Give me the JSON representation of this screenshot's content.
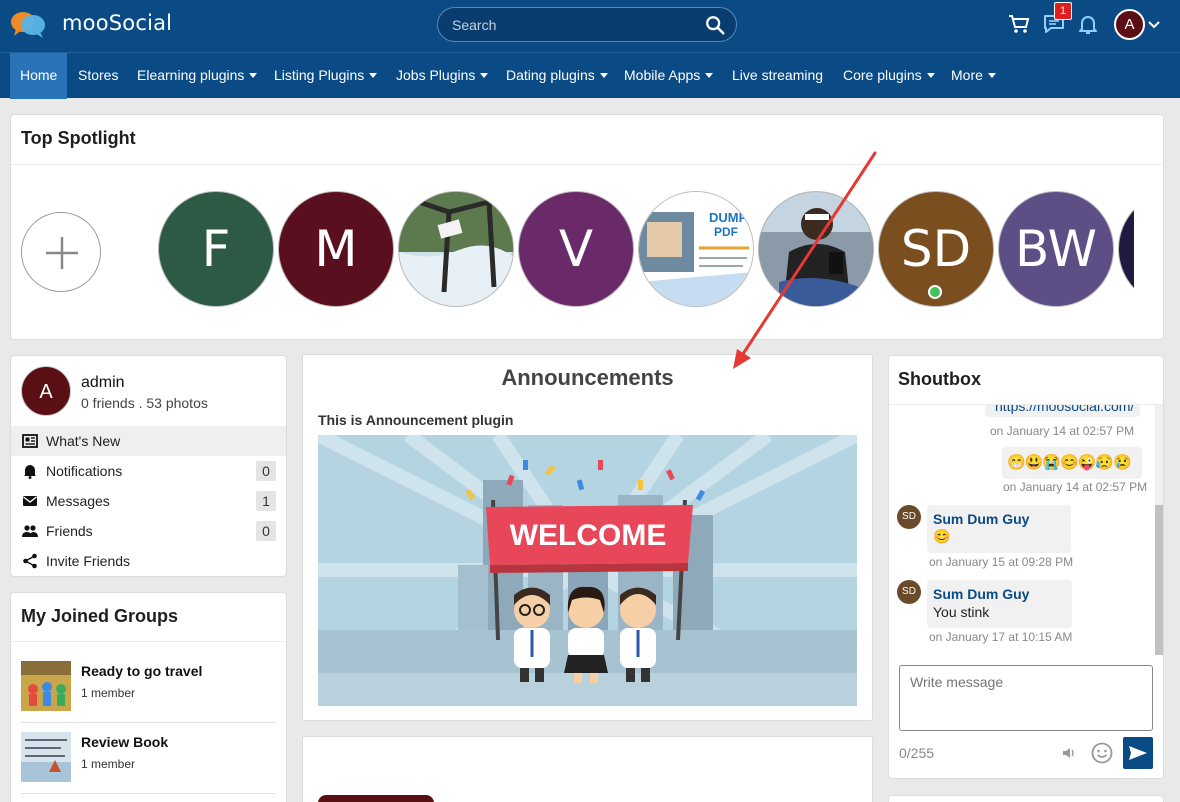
{
  "header": {
    "brand": "mooSocial",
    "search_placeholder": "Search",
    "message_badge": "1",
    "user_initial": "A"
  },
  "nav": {
    "items": [
      {
        "label": "Home"
      },
      {
        "label": "Stores"
      },
      {
        "label": "Elearning plugins"
      },
      {
        "label": "Listing Plugins"
      },
      {
        "label": "Jobs Plugins"
      },
      {
        "label": "Dating plugins"
      },
      {
        "label": "Mobile Apps"
      },
      {
        "label": "Live streaming"
      },
      {
        "label": "Core plugins"
      },
      {
        "label": "More"
      }
    ]
  },
  "spotlight": {
    "title": "Top Spotlight",
    "items": [
      {
        "initials": "F",
        "color": "#2d5a45"
      },
      {
        "initials": "M",
        "color": "#5a0f1e"
      },
      {
        "initials": "",
        "color": "#6f8a5a"
      },
      {
        "initials": "V",
        "color": "#6a2a6a"
      },
      {
        "initials": "",
        "color": "#f4f4f4"
      },
      {
        "initials": "",
        "color": "#6a5a4a"
      },
      {
        "initials": "SD",
        "color": "#7a4e1f"
      },
      {
        "initials": "BW",
        "color": "#5d4f86"
      },
      {
        "initials": "",
        "color": "#201a40"
      }
    ]
  },
  "profile": {
    "initial": "A",
    "name": "admin",
    "stats": "0 friends . 53 photos",
    "menu": [
      {
        "label": "What's New",
        "icon": "newspaper-icon"
      },
      {
        "label": "Notifications",
        "count": "0",
        "icon": "bell-icon"
      },
      {
        "label": "Messages",
        "count": "1",
        "icon": "envelope-icon"
      },
      {
        "label": "Friends",
        "count": "0",
        "icon": "people-icon"
      },
      {
        "label": "Invite Friends",
        "icon": "share-icon"
      }
    ]
  },
  "groups": {
    "title": "My Joined Groups",
    "items": [
      {
        "name": "Ready to go travel",
        "meta": "1 member"
      },
      {
        "name": "Review Book",
        "meta": "1 member"
      }
    ]
  },
  "announcements": {
    "title": "Announcements",
    "subtitle": "This is Announcement plugin",
    "banner_text": "WELCOME"
  },
  "shoutbox": {
    "title": "Shoutbox",
    "link_text": "https://moosocial.com/",
    "messages": [
      {
        "time": "on January 14 at 02:57 PM"
      },
      {
        "emojis": "😁😃😭😊😜😥😢",
        "time": "on January 14 at 02:57 PM"
      },
      {
        "avatar": "SD",
        "name": "Sum Dum Guy",
        "text": "😊",
        "time": "on January 15 at 09:28 PM"
      },
      {
        "avatar": "SD",
        "name": "Sum Dum Guy",
        "text": "You stink",
        "time": "on January 17 at 10:15 AM"
      }
    ],
    "input_placeholder": "Write message",
    "counter": "0/255"
  },
  "colors": {
    "brand_blue": "#0a4a85",
    "nav_active": "#2a73b8",
    "annotation_arrow": "#e53935"
  }
}
